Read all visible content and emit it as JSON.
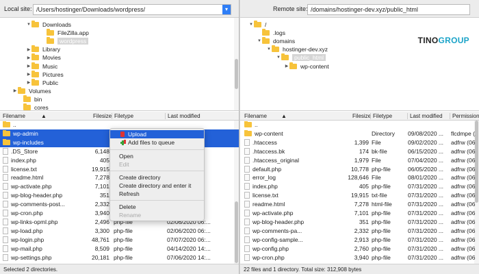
{
  "left": {
    "site_label": "Local site:",
    "path": "/Users/hostinger/Downloads/wordpress/",
    "tree": [
      {
        "label": "Downloads",
        "tri": "▼"
      },
      {
        "label": "FileZilla.app",
        "tri": ""
      },
      {
        "label": "wordpress",
        "tri": ""
      },
      {
        "label": "Library",
        "tri": "▶"
      },
      {
        "label": "Movies",
        "tri": "▶"
      },
      {
        "label": "Music",
        "tri": "▶"
      },
      {
        "label": "Pictures",
        "tri": "▶"
      },
      {
        "label": "Public",
        "tri": "▶"
      },
      {
        "label": "Volumes",
        "tri": "▶"
      },
      {
        "label": "bin",
        "tri": ""
      },
      {
        "label": "cores",
        "tri": ""
      }
    ],
    "headers": {
      "filename": "Filename",
      "filesize": "Filesize",
      "filetype": "Filetype",
      "modified": "Last modified",
      "sort": "▲"
    },
    "rows": [
      {
        "name": "..",
        "size": "",
        "type": "",
        "modified": "",
        "folder": true
      },
      {
        "name": "wp-admin",
        "size": "",
        "type": "",
        "modified": "1:5...",
        "folder": true
      },
      {
        "name": "wp-includes",
        "size": "",
        "type": "",
        "modified": "1:5...",
        "folder": true
      },
      {
        "name": ".DS_Store",
        "size": "6,148",
        "type": "",
        "modified": "7:2...",
        "folder": false
      },
      {
        "name": "index.php",
        "size": "405",
        "type": "",
        "modified": "7:2...",
        "folder": false
      },
      {
        "name": "license.txt",
        "size": "19,915",
        "type": "",
        "modified": "7:2...",
        "folder": false
      },
      {
        "name": "readme.html",
        "size": "7,278",
        "type": "",
        "modified": "7:2...",
        "folder": false
      },
      {
        "name": "wp-activate.php",
        "size": "7,101",
        "type": "",
        "modified": "7:2...",
        "folder": false
      },
      {
        "name": "wp-blog-header.php",
        "size": "351",
        "type": "",
        "modified": "7:2...",
        "folder": false
      },
      {
        "name": "wp-comments-post...",
        "size": "2,332",
        "type": "",
        "modified": "7:2...",
        "folder": false
      },
      {
        "name": "wp-cron.php",
        "size": "3,940",
        "type": "",
        "modified": "7:2...",
        "folder": false
      },
      {
        "name": "wp-links-opml.php",
        "size": "2,496",
        "type": "php-file",
        "modified": "02/06/2020 06:...",
        "folder": false
      },
      {
        "name": "wp-load.php",
        "size": "3,300",
        "type": "php-file",
        "modified": "02/06/2020 06:...",
        "folder": false
      },
      {
        "name": "wp-login.php",
        "size": "48,761",
        "type": "php-file",
        "modified": "07/07/2020 06:...",
        "folder": false
      },
      {
        "name": "wp-mail.php",
        "size": "8,509",
        "type": "php-file",
        "modified": "04/14/2020 14:...",
        "folder": false
      },
      {
        "name": "wp-settings.php",
        "size": "20,181",
        "type": "php-file",
        "modified": "07/06/2020 14:...",
        "folder": false
      }
    ],
    "status": "Selected 2 directories."
  },
  "right": {
    "site_label": "Remote site:",
    "path": "/domains/hostinger-dev.xyz/public_html",
    "tree": [
      {
        "label": "/",
        "tri": "▼"
      },
      {
        "label": ".logs",
        "tri": ""
      },
      {
        "label": "domains",
        "tri": "▼"
      },
      {
        "label": "hostinger-dev.xyz",
        "tri": "▼"
      },
      {
        "label": "public_html",
        "tri": "▼"
      },
      {
        "label": "wp-content",
        "tri": "▶"
      }
    ],
    "headers": {
      "filename": "Filename",
      "filesize": "Filesize",
      "filetype": "Filetype",
      "modified": "Last modified",
      "permissions": "Permission",
      "sort": "▲"
    },
    "rows": [
      {
        "name": "..",
        "size": "",
        "type": "",
        "modified": "",
        "perm": "",
        "folder": true
      },
      {
        "name": "wp-content",
        "size": "",
        "type": "Directory",
        "modified": "09/08/2020 ...",
        "perm": "flcdmpe (...",
        "folder": true
      },
      {
        "name": ".htaccess",
        "size": "1,399",
        "type": "File",
        "modified": "09/02/2020 ...",
        "perm": "adfrw (06...",
        "folder": false
      },
      {
        "name": ".htaccess.bk",
        "size": "174",
        "type": "bk-file",
        "modified": "06/15/2020 ...",
        "perm": "adfrw (06...",
        "folder": false
      },
      {
        "name": ".htaccess_original",
        "size": "1,979",
        "type": "File",
        "modified": "07/04/2020 ...",
        "perm": "adfrw (06...",
        "folder": false
      },
      {
        "name": "default.php",
        "size": "10,778",
        "type": "php-file",
        "modified": "06/05/2020 ...",
        "perm": "adfrw (06...",
        "folder": false
      },
      {
        "name": "error_log",
        "size": "128,646",
        "type": "File",
        "modified": "08/01/2020 ...",
        "perm": "adfrw (06...",
        "folder": false
      },
      {
        "name": "index.php",
        "size": "405",
        "type": "php-file",
        "modified": "07/31/2020 ...",
        "perm": "adfrw (06...",
        "folder": false
      },
      {
        "name": "license.txt",
        "size": "19,915",
        "type": "txt-file",
        "modified": "07/31/2020 ...",
        "perm": "adfrw (06...",
        "folder": false
      },
      {
        "name": "readme.html",
        "size": "7,278",
        "type": "html-file",
        "modified": "07/31/2020 ...",
        "perm": "adfrw (06...",
        "folder": false
      },
      {
        "name": "wp-activate.php",
        "size": "7,101",
        "type": "php-file",
        "modified": "07/31/2020 ...",
        "perm": "adfrw (06...",
        "folder": false
      },
      {
        "name": "wp-blog-header.php",
        "size": "351",
        "type": "php-file",
        "modified": "07/31/2020 ...",
        "perm": "adfrw (06...",
        "folder": false
      },
      {
        "name": "wp-comments-pa...",
        "size": "2,332",
        "type": "php-file",
        "modified": "07/31/2020 ...",
        "perm": "adfrw (06...",
        "folder": false
      },
      {
        "name": "wp-config-sample...",
        "size": "2,913",
        "type": "php-file",
        "modified": "07/31/2020 ...",
        "perm": "adfrw (06...",
        "folder": false
      },
      {
        "name": "wp-config.php",
        "size": "2,760",
        "type": "php-file",
        "modified": "07/31/2020 ...",
        "perm": "adfrw (06...",
        "folder": false
      },
      {
        "name": "wp-cron.php",
        "size": "3,940",
        "type": "php-file",
        "modified": "07/31/2020 ...",
        "perm": "adfrw (06...",
        "folder": false
      }
    ],
    "status": "22 files and 1 directory. Total size: 312,908 bytes"
  },
  "context_menu": {
    "upload": "Upload",
    "add_queue": "Add files to queue",
    "open": "Open",
    "edit": "Edit",
    "create_dir": "Create directory",
    "create_dir_enter": "Create directory and enter it",
    "refresh": "Refresh",
    "delete": "Delete",
    "rename": "Rename"
  },
  "logo": {
    "part1": "TINO",
    "part2": "GROUP"
  },
  "colors": {
    "selection": "#2361d8",
    "folder": "#f7c33b",
    "dropdown": "#2f7ef6"
  }
}
